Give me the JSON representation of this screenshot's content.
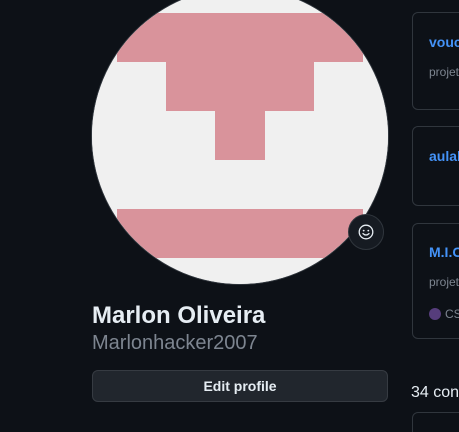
{
  "profile": {
    "name": "Marlon Oliveira",
    "login": "Marlonhacker2007",
    "edit_profile_label": "Edit profile",
    "avatar_colors": {
      "background": "#f0f0f0",
      "foreground": "#d9939b"
    }
  },
  "repos": [
    {
      "title": "vouc",
      "description": "projet"
    },
    {
      "title": "aulal",
      "description": ""
    },
    {
      "title": "M.I.C",
      "description": "projet",
      "language": "CSS",
      "language_color": "#563d7c"
    }
  ],
  "contributions_partial": "34 con",
  "colors": {
    "link": "#4493f8",
    "muted": "#7d8590",
    "border": "#30363d",
    "button_bg": "#21262d",
    "page_bg": "#0d1117"
  }
}
